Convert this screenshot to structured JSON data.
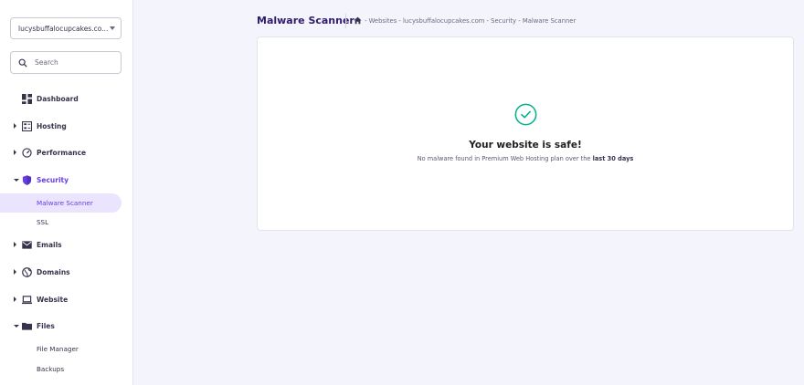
{
  "sidebar": {
    "site_selector": "lucysbuffalocupcakes.co...",
    "search_placeholder": "Search",
    "items": [
      {
        "label": "Dashboard",
        "icon": "dashboard-icon"
      },
      {
        "label": "Hosting",
        "icon": "hosting-icon"
      },
      {
        "label": "Performance",
        "icon": "performance-icon"
      },
      {
        "label": "Security",
        "icon": "security-shield-icon"
      },
      {
        "label": "Emails",
        "icon": "email-icon"
      },
      {
        "label": "Domains",
        "icon": "globe-icon"
      },
      {
        "label": "Website",
        "icon": "laptop-icon"
      },
      {
        "label": "Files",
        "icon": "folder-icon"
      }
    ],
    "security_sub": [
      "Malware Scanner",
      "SSL"
    ],
    "files_sub": [
      "File Manager",
      "Backups"
    ]
  },
  "header": {
    "title": "Malware Scanner",
    "breadcrumb": "- Websites - lucysbuffalocupcakes.com - Security - Malware Scanner"
  },
  "result": {
    "title": "Your website is safe!",
    "desc_prefix": "No malware found in Premium Web Hosting plan over the ",
    "desc_bold": "last 30 days"
  },
  "colors": {
    "accent": "#673de6",
    "success": "#00b090",
    "security_icon": "#673de6",
    "background": "#f4f4fd"
  }
}
